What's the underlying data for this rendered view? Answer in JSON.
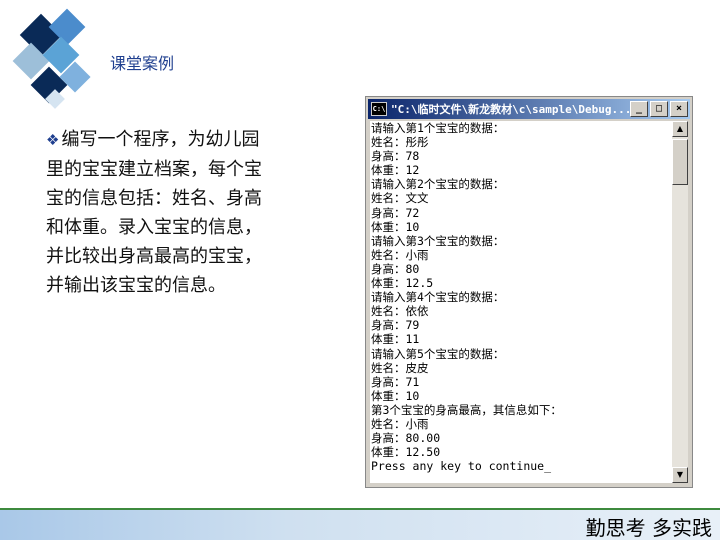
{
  "slide": {
    "title": "课堂案例",
    "bullet_icon": "diamond-bullet",
    "body_lines": [
      "编写一个程序，为幼儿园",
      "里的宝宝建立档案，每个宝",
      "宝的信息包括：姓名、身高",
      "和体重。录入宝宝的信息，",
      "并比较出身高最高的宝宝，",
      "并输出该宝宝的信息。"
    ],
    "footer": "勤思考  多实践"
  },
  "console_window": {
    "title": "\"C:\\临时文件\\新龙教材\\c\\sample\\Debug...",
    "buttons": {
      "minimize": "_",
      "maximize": "□",
      "close": "×"
    },
    "lines": [
      "请输入第1个宝宝的数据：",
      "姓名：彤彤",
      "身高：78",
      "体重：12",
      "请输入第2个宝宝的数据：",
      "姓名：文文",
      "身高：72",
      "体重：10",
      "请输入第3个宝宝的数据：",
      "姓名：小雨",
      "身高：80",
      "体重：12.5",
      "请输入第4个宝宝的数据：",
      "姓名：依依",
      "身高：79",
      "体重：11",
      "请输入第5个宝宝的数据：",
      "姓名：皮皮",
      "身高：71",
      "体重：10",
      "第3个宝宝的身高最高，其信息如下：",
      "姓名：小雨",
      "身高：80.00",
      "体重：12.50",
      "Press any key to continue_"
    ]
  }
}
